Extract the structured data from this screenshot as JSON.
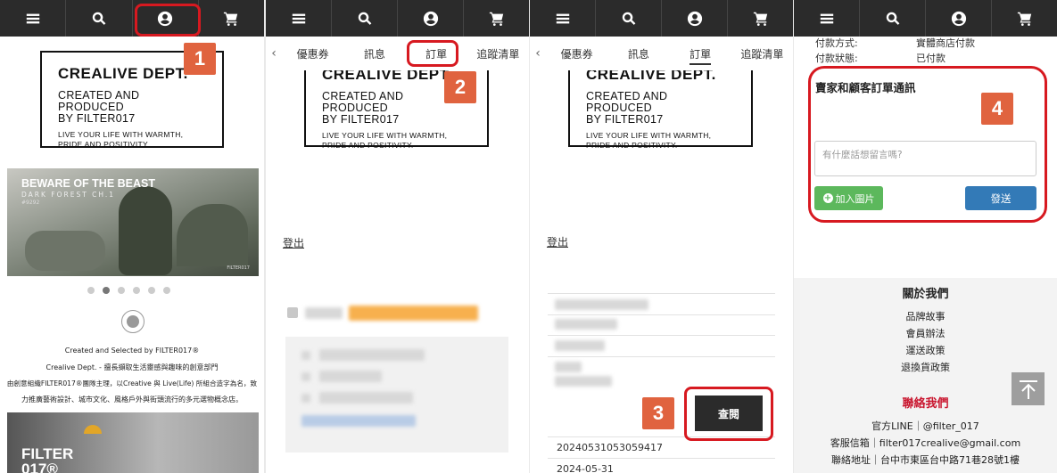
{
  "steps": [
    "1",
    "2",
    "3",
    "4"
  ],
  "nav_icons": [
    "menu-icon",
    "search-icon",
    "user-icon",
    "cart-icon"
  ],
  "logo": {
    "line1": "CREALIVE DEPT.",
    "line2a": "CREATED AND PRODUCED",
    "line2b": "BY FILTER017",
    "line3a": "LIVE YOUR LIFE WITH WARMTH,",
    "line3b": "PRIDE AND POSITIVITY."
  },
  "panel1": {
    "banner_title": "BEWARE OF THE BEAST",
    "banner_sub": "DARK FOREST CH.1",
    "banner_code": "#9292",
    "banner_brand": "FILTER017",
    "carousel_active_index": 1,
    "credit": "Created and Selected by FILTER017®",
    "desc1": "Crealive Dept. - 擅長擷取生活靈感與趣味的創意部門",
    "desc2": "由創意組織FILTER017®團隊主理，以Creative 與 Live(Life) 所組合造字為名，致",
    "desc3": "力推廣藝術設計、城市文化、風格戶外與街頭流行的多元選物概念店。",
    "photo_text1": "FILTER",
    "photo_text2": "017®"
  },
  "subtabs": {
    "back": "‹",
    "coupon": "優惠券",
    "message": "訊息",
    "orders": "訂單",
    "wishlist": "追蹤清單"
  },
  "logout": "登出",
  "panel3": {
    "view_button": "查閱",
    "order_no": "20240531053059417",
    "order_date": "2024-05-31"
  },
  "panel4": {
    "payment_method_label": "付款方式:",
    "payment_method_value": "實體商店付款",
    "payment_status_label": "付款狀態:",
    "payment_status_value": "已付款",
    "chat_title": "賣家和顧客訂單通訊",
    "placeholder": "有什麼話想留言嗎?",
    "add_image": "加入圖片",
    "send": "發送",
    "about_title": "關於我們",
    "about_links": [
      "品牌故事",
      "會員辦法",
      "運送政策",
      "退換貨政策"
    ],
    "contact_title": "聯絡我們",
    "contact_lines": [
      "官方LINE｜@filter_017",
      "客服信箱｜filter017crealive@gmail.com",
      "聯絡地址｜台中市東區台中路71巷28號1樓"
    ]
  },
  "colors": {
    "nav_bg": "#2b2b2b",
    "highlight_red": "#d71920",
    "step_badge": "#e0633f",
    "add_image_green": "#5cb85c",
    "send_blue": "#337ab7",
    "contact_red": "#c9152e"
  }
}
